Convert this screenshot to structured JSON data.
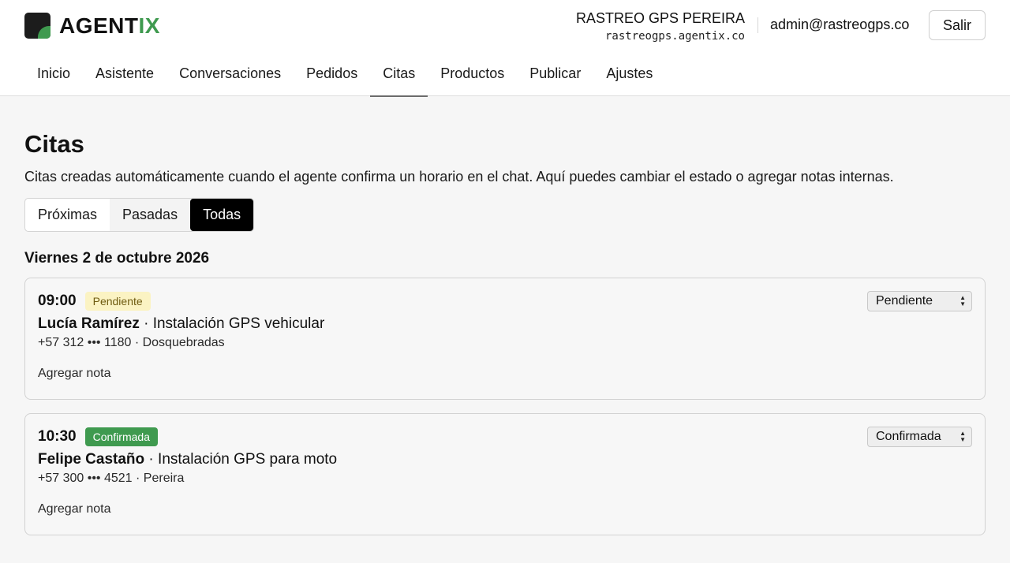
{
  "header": {
    "brand_main": "AGENT",
    "brand_accent": "IX",
    "org_name": "RASTREO GPS PEREIRA",
    "org_domain": "rastreogps.agentix.co",
    "email": "admin@rastreogps.co",
    "logout_label": "Salir",
    "accent_color": "#3f9a4f"
  },
  "nav": {
    "items": [
      "Inicio",
      "Asistente",
      "Conversaciones",
      "Pedidos",
      "Citas",
      "Productos",
      "Publicar",
      "Ajustes"
    ],
    "active": "Citas"
  },
  "page": {
    "title": "Citas",
    "description": "Citas creadas automáticamente cuando el agente confirma un horario en el chat. Aquí puedes cambiar el estado o agregar notas internas."
  },
  "filters": {
    "tabs": [
      "Próximas",
      "Pasadas",
      "Todas"
    ],
    "active": "Todas"
  },
  "day": {
    "heading": "Viernes 2 de octubre 2026"
  },
  "appointments": [
    {
      "time": "09:00",
      "badge": "Pendiente",
      "name": "Lucía Ramírez",
      "service": " · Instalación GPS vehicular",
      "contact": "+57 312 ••• 1180 · Dosquebradas",
      "note_label": "Agregar nota",
      "status_value": "Pendiente"
    },
    {
      "time": "10:30",
      "badge": "Confirmada",
      "name": "Felipe Castaño",
      "service": " · Instalación GPS para moto",
      "contact": "+57 300 ••• 4521 · Pereira",
      "note_label": "Agregar nota",
      "status_value": "Confirmada"
    }
  ]
}
